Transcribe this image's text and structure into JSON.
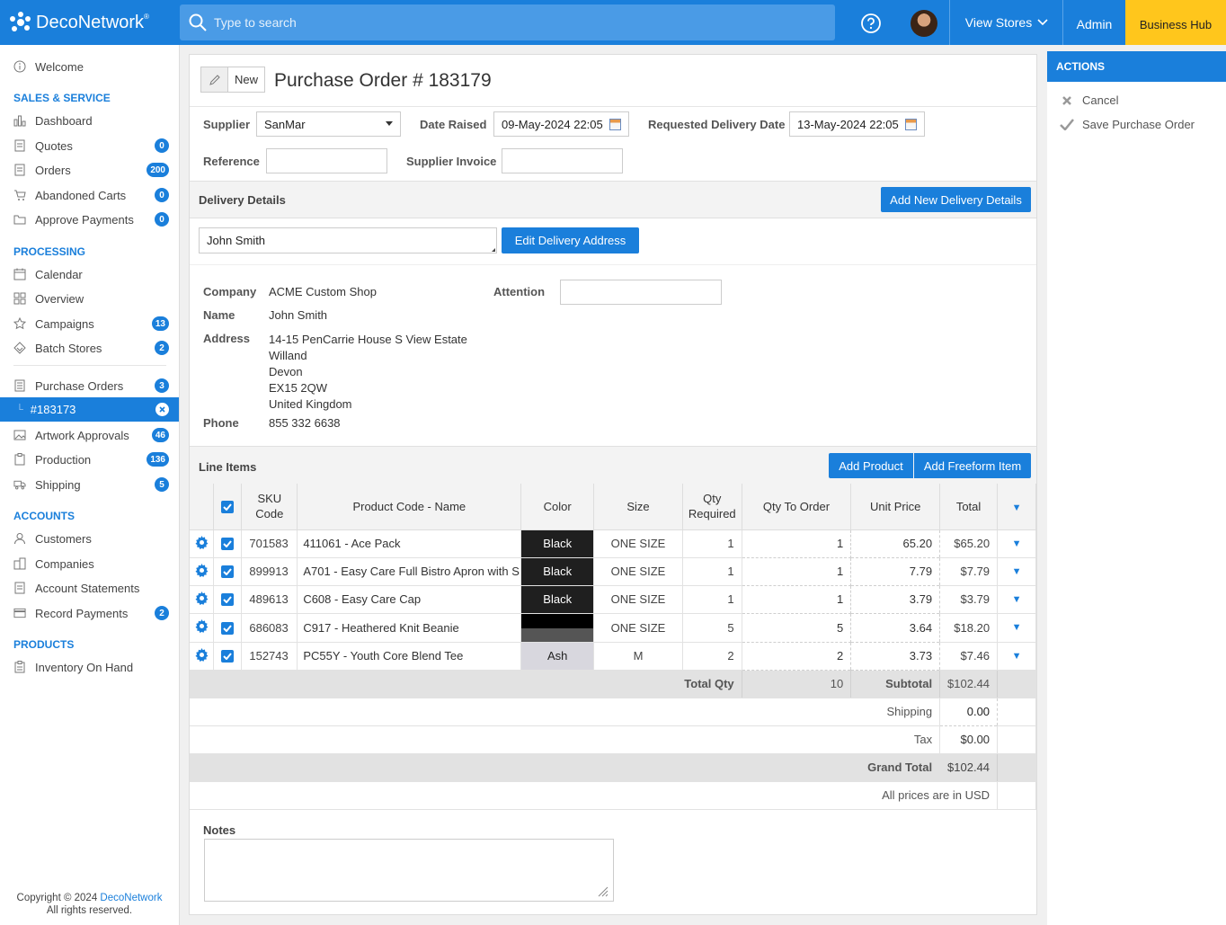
{
  "app": {
    "logo_text": "DecoNetwork",
    "logo_mark": "®"
  },
  "header": {
    "search_placeholder": "Type to search",
    "view_stores": "View Stores",
    "admin": "Admin",
    "business_hub": "Business Hub"
  },
  "sidebar": {
    "welcome": "Welcome",
    "sections": {
      "sales": "SALES & SERVICE",
      "processing": "PROCESSING",
      "accounts": "ACCOUNTS",
      "products": "PRODUCTS"
    },
    "items": {
      "dashboard": "Dashboard",
      "quotes": "Quotes",
      "quotes_badge": "0",
      "orders": "Orders",
      "orders_badge": "200",
      "abandoned": "Abandoned Carts",
      "abandoned_badge": "0",
      "approve": "Approve Payments",
      "approve_badge": "0",
      "calendar": "Calendar",
      "overview": "Overview",
      "campaigns": "Campaigns",
      "campaigns_badge": "13",
      "batch": "Batch Stores",
      "batch_badge": "2",
      "purchase_orders": "Purchase Orders",
      "purchase_orders_badge": "3",
      "current_po": "#183173",
      "artwork": "Artwork Approvals",
      "artwork_badge": "46",
      "production": "Production",
      "production_badge": "136",
      "shipping": "Shipping",
      "shipping_badge": "5",
      "customers": "Customers",
      "companies": "Companies",
      "statements": "Account Statements",
      "record_payments": "Record Payments",
      "record_payments_badge": "2",
      "inventory": "Inventory On Hand"
    },
    "copyright": "Copyright © 2024",
    "copyright_link": "DecoNetwork",
    "rights": "All rights reserved."
  },
  "po": {
    "status": "New",
    "title": "Purchase Order # 183179",
    "supplier_label": "Supplier",
    "supplier_value": "SanMar",
    "date_raised_label": "Date Raised",
    "date_raised_value": "09-May-2024 22:05",
    "req_delivery_label": "Requested Delivery Date",
    "req_delivery_value": "13-May-2024 22:05",
    "reference_label": "Reference",
    "reference_value": "",
    "supplier_invoice_label": "Supplier Invoice",
    "supplier_invoice_value": ""
  },
  "delivery": {
    "section_title": "Delivery Details",
    "add_button": "Add New Delivery Details",
    "selected": "John Smith",
    "edit_button": "Edit Delivery Address",
    "company_label": "Company",
    "company": "ACME Custom Shop",
    "name_label": "Name",
    "name": "John Smith",
    "address_label": "Address",
    "address_lines": [
      "14-15 PenCarrie House S View Estate",
      "Willand",
      "Devon",
      "EX15 2QW",
      "United Kingdom"
    ],
    "phone_label": "Phone",
    "phone": "855 332 6638",
    "attention_label": "Attention",
    "attention_value": ""
  },
  "line_items": {
    "section_title": "Line Items",
    "add_product": "Add Product",
    "add_freeform": "Add Freeform Item",
    "headers": {
      "sku": "SKU Code",
      "product": "Product Code - Name",
      "color": "Color",
      "size": "Size",
      "qty_required": "Qty Required",
      "qty_order": "Qty To Order",
      "unit_price": "Unit Price",
      "total": "Total"
    },
    "rows": [
      {
        "sku": "701583",
        "product": "411061 - Ace Pack",
        "color": "Black",
        "color_bg": "#1f1f1f",
        "size": "ONE SIZE",
        "qty_required": "1",
        "qty_order": "1",
        "unit_price": "65.20",
        "total": "$65.20"
      },
      {
        "sku": "899913",
        "product": "A701 - Easy Care Full Bistro Apron with S",
        "color": "Black",
        "color_bg": "#1f1f1f",
        "size": "ONE SIZE",
        "qty_required": "1",
        "qty_order": "1",
        "unit_price": "7.79",
        "total": "$7.79"
      },
      {
        "sku": "489613",
        "product": "C608 - Easy Care Cap",
        "color": "Black",
        "color_bg": "#1f1f1f",
        "size": "ONE SIZE",
        "qty_required": "1",
        "qty_order": "1",
        "unit_price": "3.79",
        "total": "$3.79"
      },
      {
        "sku": "686083",
        "product": "C917 - Heathered Knit Beanie",
        "color": "",
        "color_bg": "#000000",
        "size": "ONE SIZE",
        "qty_required": "5",
        "qty_order": "5",
        "unit_price": "3.64",
        "total": "$18.20"
      },
      {
        "sku": "152743",
        "product": "PC55Y - Youth Core Blend Tee",
        "color": "Ash",
        "color_bg": "#d8d7de",
        "size": "M",
        "qty_required": "2",
        "qty_order": "2",
        "unit_price": "3.73",
        "total": "$7.46"
      }
    ],
    "total_qty_label": "Total Qty",
    "total_qty": "10",
    "subtotal_label": "Subtotal",
    "subtotal": "$102.44",
    "shipping_label": "Shipping",
    "shipping": "0.00",
    "tax_label": "Tax",
    "tax": "$0.00",
    "grand_total_label": "Grand Total",
    "grand_total": "$102.44",
    "currency_note": "All prices are in USD"
  },
  "notes": {
    "label": "Notes",
    "value": ""
  },
  "actions": {
    "title": "ACTIONS",
    "cancel": "Cancel",
    "save": "Save Purchase Order"
  },
  "colors": {
    "accent": "#1a7fdb",
    "business_hub": "#ffc61c"
  }
}
